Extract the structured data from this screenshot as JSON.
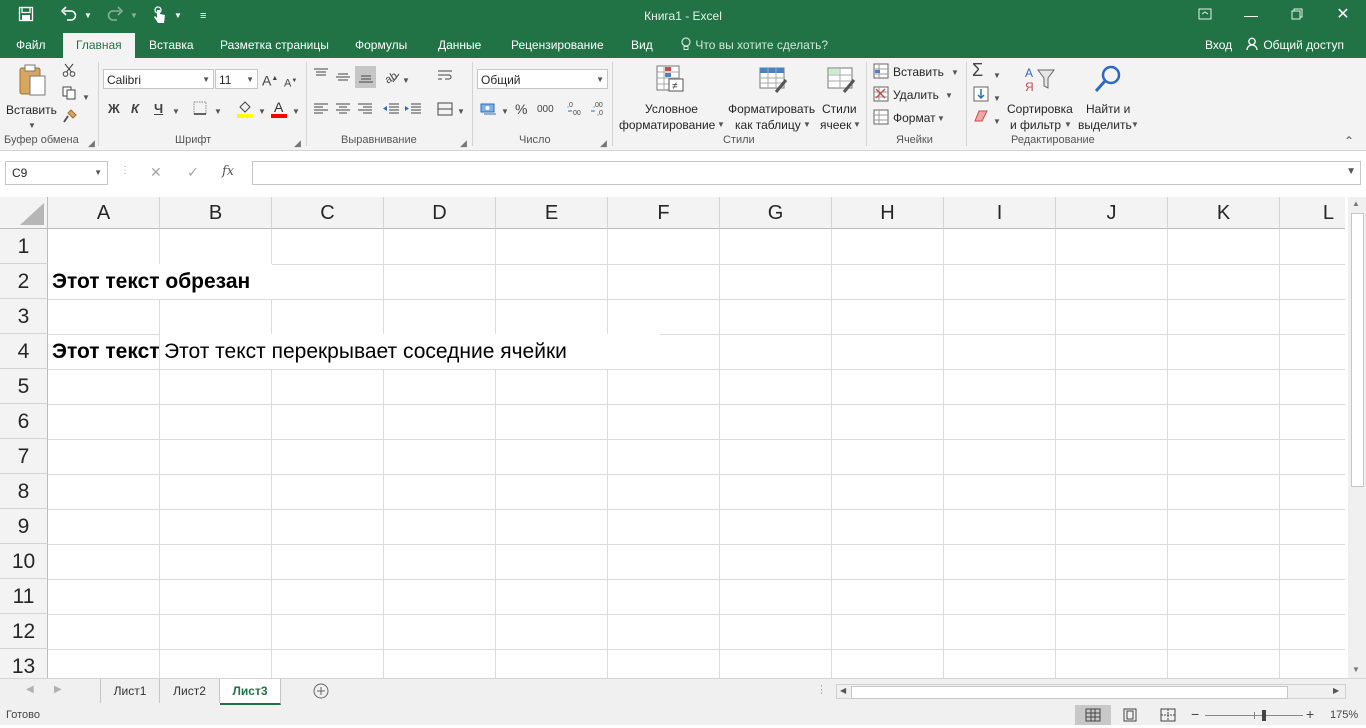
{
  "window": {
    "title": "Книга1 - Excel"
  },
  "qat": {
    "save_icon": "save-icon",
    "undo_icon": "undo-icon",
    "redo_icon": "redo-icon",
    "touch_icon": "touch-mode-icon",
    "customize_icon": "customize-qat-icon"
  },
  "tabs": [
    {
      "label": "Файл"
    },
    {
      "label": "Главная"
    },
    {
      "label": "Вставка"
    },
    {
      "label": "Разметка страницы"
    },
    {
      "label": "Формулы"
    },
    {
      "label": "Данные"
    },
    {
      "label": "Рецензирование"
    },
    {
      "label": "Вид"
    }
  ],
  "tell_me": "Что вы хотите сделать?",
  "signin": "Вход",
  "share": "Общий доступ",
  "ribbon": {
    "clipboard": {
      "paste": "Вставить",
      "label": "Буфер обмена"
    },
    "font": {
      "name": "Calibri",
      "size": "11",
      "bold": "Ж",
      "italic": "К",
      "underline": "Ч",
      "label": "Шрифт"
    },
    "alignment": {
      "label": "Выравнивание"
    },
    "number": {
      "format": "Общий",
      "percent": "%",
      "thousands": "000",
      "label": "Число"
    },
    "styles": {
      "conditional_line1": "Условное",
      "conditional_line2": "форматирование",
      "table_line1": "Форматировать",
      "table_line2": "как таблицу",
      "cell_styles_line1": "Стили",
      "cell_styles_line2": "ячеек",
      "label": "Стили"
    },
    "cells": {
      "insert": "Вставить",
      "delete": "Удалить",
      "format": "Формат",
      "label": "Ячейки"
    },
    "editing": {
      "sort_line1": "Сортировка",
      "sort_line2": "и фильтр",
      "find_line1": "Найти и",
      "find_line2": "выделить",
      "label": "Редактирование"
    }
  },
  "formula_bar": {
    "name_box": "C9",
    "cancel": "✕",
    "enter": "✓",
    "fx": "fx",
    "value": ""
  },
  "grid": {
    "columns": [
      "A",
      "B",
      "C",
      "D",
      "E",
      "F",
      "G",
      "H",
      "I",
      "J",
      "K",
      "L"
    ],
    "rows": [
      "1",
      "2",
      "3",
      "4",
      "5",
      "6",
      "7",
      "8",
      "9",
      "10",
      "11",
      "12",
      "13"
    ],
    "cells": {
      "A2": "Этот текст обрезан",
      "A4": "Этот текст обрезан",
      "B4": "Этот текст перекрывает соседние ячейки"
    }
  },
  "sheets": [
    {
      "label": "Лист1"
    },
    {
      "label": "Лист2"
    },
    {
      "label": "Лист3"
    }
  ],
  "status": {
    "ready": "Готово",
    "zoom": "175%"
  },
  "colors": {
    "accent": "#217346"
  }
}
